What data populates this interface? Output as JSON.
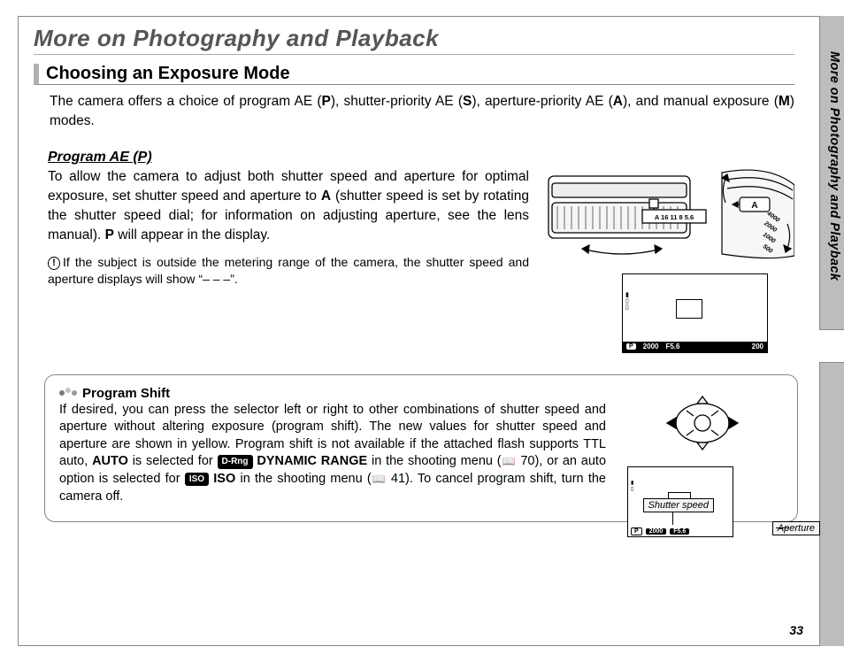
{
  "page": {
    "title": "More on Photography and Playback",
    "section_heading": "Choosing an Exposure Mode",
    "page_number": "33",
    "side_tab": "More on Photography and Playback"
  },
  "intro": {
    "part1": "The camera offers a choice of program AE (",
    "p": "P",
    "part2": "), shutter-priority AE (",
    "s": "S",
    "part3": "), aperture-priority AE (",
    "a": "A",
    "part4": "), and manual exposure (",
    "m": "M",
    "part5": ") modes."
  },
  "sub": {
    "heading": "Program AE (P)",
    "body_a": "To allow the camera to adjust both shutter speed and aperture for optimal exposure, set shutter speed and aperture to ",
    "body_a_bold": "A",
    "body_b": " (shut­ter speed is set by rotating the shutter speed dial; for information on adjusting aperture, see the lens manual).  ",
    "body_b_bold": "P",
    "body_c": " will appear in the display.",
    "note": "If the subject is outside the metering range of the camera, the shutter speed and aperture displays will show “– – –”."
  },
  "lens": {
    "ring_numbers": "A  16  11  8  5.6",
    "dial_marker": "A",
    "dial_numbers": [
      "4000",
      "2000",
      "1000",
      "500"
    ]
  },
  "lcd": {
    "p_badge": "P",
    "shutter": "2000",
    "fstop": "F5.6",
    "iso": "200"
  },
  "callout": {
    "title": "Program Shift",
    "t1": "If desired, you can press the selector left or right to other combinations of shutter speed and aperture without altering exposure (program shift).  The new values for shutter speed and aperture are shown in yellow.  Program shift is not available if the attached flash supports TTL auto, ",
    "auto": "AUTO",
    "t2": " is selected for ",
    "drng_badge": "D-Rng",
    "dynamic_range": " DYNAMIC RANGE",
    "t3": " in the shooting menu (",
    "pg70": " 70), or an auto option is selected for ",
    "iso_badge": "ISO",
    "iso": " ISO",
    "t4": " in the shoot­ing menu (",
    "pg41": " 41).  To cancel program shift, turn the camera off."
  },
  "callout_fig": {
    "p_badge": "P",
    "shutter": "2000",
    "fstop": "F5.6",
    "label_ss": "Shutter speed",
    "label_ap": "Aperture"
  }
}
